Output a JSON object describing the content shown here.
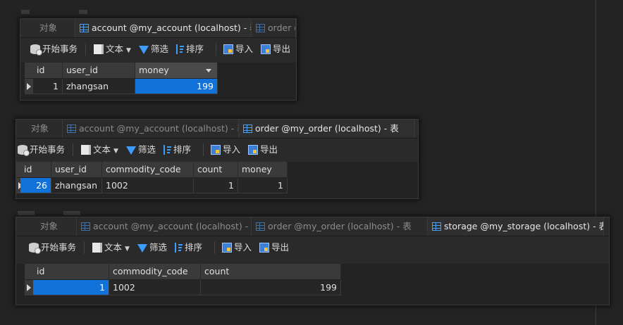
{
  "panel1": {
    "tabs": [
      {
        "label": "对象"
      },
      {
        "label": "account @my_account (localhost) - 表"
      },
      {
        "label": "order @"
      }
    ],
    "toolbar": {
      "begin": "开始事务",
      "text": "文本",
      "filter": "筛选",
      "sort": "排序",
      "import": "导入",
      "export": "导出"
    },
    "columns": [
      "id",
      "user_id",
      "money"
    ],
    "rows": [
      {
        "id": "1",
        "user_id": "zhangsan",
        "money": "199"
      }
    ]
  },
  "panel2": {
    "tabs": [
      {
        "label": "对象"
      },
      {
        "label": "account @my_account (localhost) - 表"
      },
      {
        "label": "order @my_order (localhost) - 表"
      }
    ],
    "toolbar": {
      "begin": "开始事务",
      "text": "文本",
      "filter": "筛选",
      "sort": "排序",
      "import": "导入",
      "export": "导出"
    },
    "columns": [
      "id",
      "user_id",
      "commodity_code",
      "count",
      "money"
    ],
    "rows": [
      {
        "id": "26",
        "user_id": "zhangsan",
        "commodity_code": "1002",
        "count": "1",
        "money": "1"
      }
    ]
  },
  "panel3": {
    "tabs": [
      {
        "label": "对象"
      },
      {
        "label": "account @my_account (localhost) - 表"
      },
      {
        "label": "order @my_order (localhost) - 表"
      },
      {
        "label": "storage @my_storage (localhost) - 表"
      }
    ],
    "toolbar": {
      "begin": "开始事务",
      "text": "文本",
      "filter": "筛选",
      "sort": "排序",
      "import": "导入",
      "export": "导出"
    },
    "columns": [
      "id",
      "commodity_code",
      "count"
    ],
    "rows": [
      {
        "id": "1",
        "commodity_code": "1002",
        "count": "199"
      }
    ]
  },
  "colors": {
    "selection": "#1172d9",
    "background": "#232323",
    "tab_icon": "#4aa0ff"
  }
}
